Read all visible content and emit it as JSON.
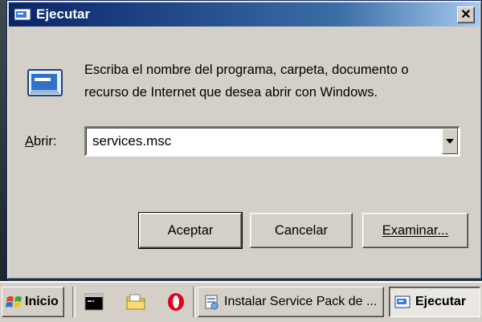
{
  "dialog": {
    "title": "Ejecutar",
    "close_label": "✕",
    "prompt": "Escriba el nombre del programa, carpeta, documento o recurso de Internet que desea abrir con Windows.",
    "open_label_accel": "A",
    "open_label_rest": "brir:",
    "open_value": "services.msc",
    "buttons": {
      "accept": "Aceptar",
      "cancel": "Cancelar",
      "browse": "Examinar..."
    }
  },
  "taskbar": {
    "start_label": "Inicio",
    "tasks": [
      {
        "label": "Instalar Service Pack de ..."
      },
      {
        "label": "Ejecutar"
      }
    ]
  },
  "icons": {
    "window": "run-dialog-icon",
    "close": "close-icon",
    "dropdown": "chevron-down-icon",
    "start": "windows-logo-icon",
    "quicklaunch": [
      "command-prompt-icon",
      "folder-icon",
      "opera-icon"
    ],
    "task_installer": "installer-icon",
    "task_run": "run-dialog-icon"
  },
  "colors": {
    "titlebar_start": "#0a246a",
    "titlebar_end": "#a6caf0",
    "face": "#d4d0c8"
  }
}
